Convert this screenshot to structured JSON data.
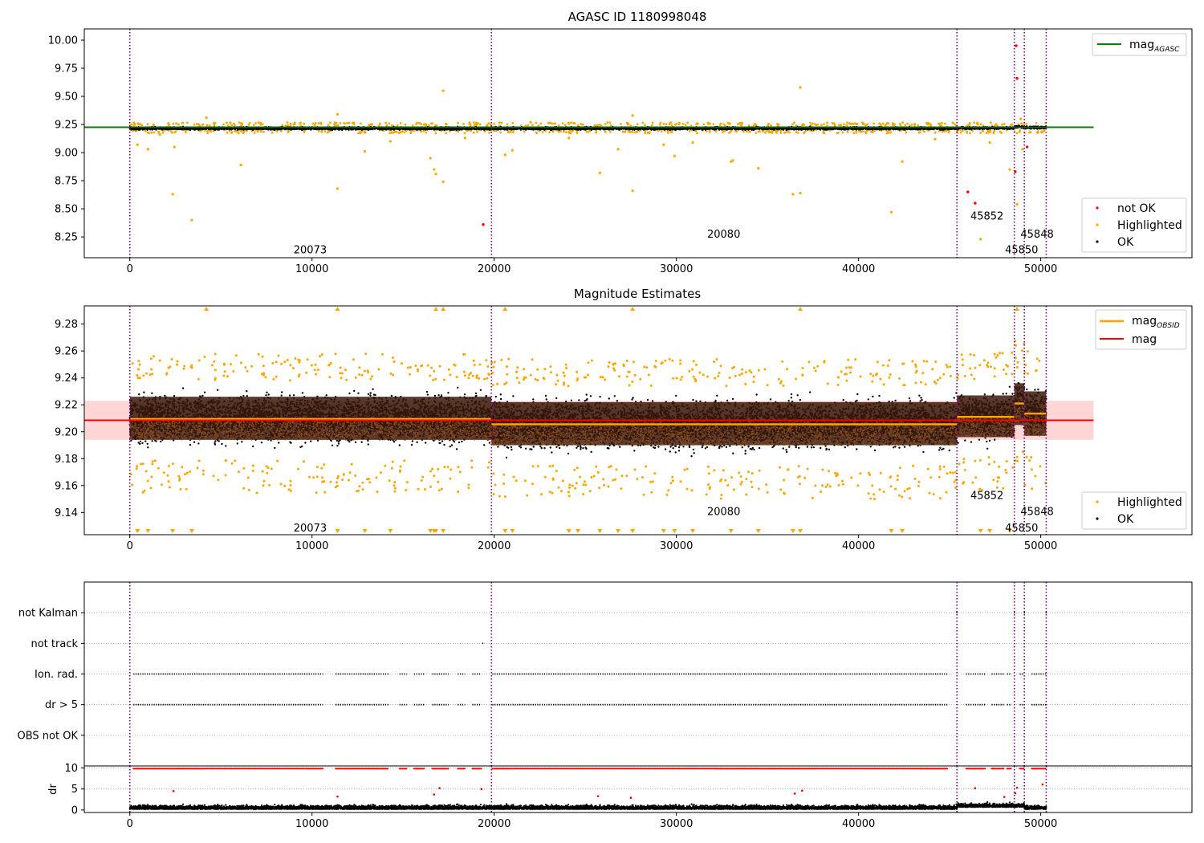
{
  "colors": {
    "ok": "#000000",
    "highlighted": "#ffa500",
    "not_ok": "#ff0000",
    "mag_agasc": "#008000",
    "mag_obsid": "#ffa500",
    "mag": "#ff0000",
    "mag_band": "#ffd6d6",
    "obsid_band": "#3a1a0a",
    "vline": "#800080"
  },
  "chart_data": [
    {
      "type": "scatter",
      "title": "AGASC ID 1180998048",
      "xlim": [
        -2500,
        58300
      ],
      "ylim": [
        8.065,
        10.1
      ],
      "xticks": [
        0,
        10000,
        20000,
        30000,
        40000,
        50000
      ],
      "yticks": [
        8.25,
        8.5,
        8.75,
        9.0,
        9.25,
        9.5,
        9.75,
        10.0
      ],
      "ytick_labels": [
        "8.25",
        "8.50",
        "8.75",
        "9.00",
        "9.25",
        "9.50",
        "9.75",
        "10.00"
      ],
      "grid": false,
      "obsid_boundaries": [
        0,
        19850,
        45400,
        48550,
        49100,
        50300
      ],
      "obsid_labels": [
        {
          "text": "20073",
          "x": 9900,
          "y": 8.14
        },
        {
          "text": "20080",
          "x": 32600,
          "y": 8.28
        },
        {
          "text": "45852",
          "x": 47050,
          "y": 8.44
        },
        {
          "text": "45848",
          "x": 49800,
          "y": 8.28
        },
        {
          "text": "45850",
          "x": 48950,
          "y": 8.14
        }
      ],
      "lines": [
        {
          "name": "mag_AGASC",
          "label_main": "mag",
          "label_sub": "AGASC",
          "y": 9.225,
          "x_range": [
            -2500,
            52900
          ]
        }
      ],
      "band": {
        "center": 9.21,
        "half_width": 0.018
      },
      "highlighted_points": [
        {
          "x": 420,
          "y": 9.07
        },
        {
          "x": 1000,
          "y": 9.03
        },
        {
          "x": 1650,
          "y": 9.16
        },
        {
          "x": 2350,
          "y": 8.63
        },
        {
          "x": 2450,
          "y": 9.05
        },
        {
          "x": 3400,
          "y": 8.4
        },
        {
          "x": 4200,
          "y": 9.31
        },
        {
          "x": 6100,
          "y": 8.89
        },
        {
          "x": 11400,
          "y": 8.68
        },
        {
          "x": 11400,
          "y": 9.34
        },
        {
          "x": 12900,
          "y": 9.01
        },
        {
          "x": 14300,
          "y": 9.1
        },
        {
          "x": 16500,
          "y": 8.95
        },
        {
          "x": 16700,
          "y": 8.85
        },
        {
          "x": 16800,
          "y": 8.81
        },
        {
          "x": 17200,
          "y": 9.55
        },
        {
          "x": 17200,
          "y": 8.74
        },
        {
          "x": 18400,
          "y": 9.13
        },
        {
          "x": 20600,
          "y": 8.98
        },
        {
          "x": 21000,
          "y": 9.02
        },
        {
          "x": 22000,
          "y": 9.27
        },
        {
          "x": 24100,
          "y": 9.13
        },
        {
          "x": 25800,
          "y": 8.82
        },
        {
          "x": 26800,
          "y": 9.03
        },
        {
          "x": 27600,
          "y": 8.66
        },
        {
          "x": 27600,
          "y": 9.33
        },
        {
          "x": 29300,
          "y": 9.07
        },
        {
          "x": 29900,
          "y": 8.97
        },
        {
          "x": 30900,
          "y": 9.09
        },
        {
          "x": 33000,
          "y": 8.92
        },
        {
          "x": 33100,
          "y": 8.93
        },
        {
          "x": 34500,
          "y": 8.86
        },
        {
          "x": 36400,
          "y": 8.63
        },
        {
          "x": 36800,
          "y": 8.64
        },
        {
          "x": 36800,
          "y": 9.58
        },
        {
          "x": 41800,
          "y": 8.47
        },
        {
          "x": 42400,
          "y": 8.92
        },
        {
          "x": 46700,
          "y": 8.23
        },
        {
          "x": 47200,
          "y": 9.09
        },
        {
          "x": 48300,
          "y": 8.85
        },
        {
          "x": 48700,
          "y": 8.54
        },
        {
          "x": 48900,
          "y": 9.3
        },
        {
          "x": 49000,
          "y": 9.03
        },
        {
          "x": 44200,
          "y": 9.12
        }
      ],
      "not_ok_points": [
        {
          "x": 19400,
          "y": 8.36
        },
        {
          "x": 46000,
          "y": 8.65
        },
        {
          "x": 46400,
          "y": 8.55
        },
        {
          "x": 48600,
          "y": 8.83
        },
        {
          "x": 48700,
          "y": 9.66
        },
        {
          "x": 48650,
          "y": 9.95
        },
        {
          "x": 49250,
          "y": 9.05
        }
      ],
      "legends": [
        {
          "position": "upper-right",
          "entries": [
            {
              "kind": "line",
              "main": "mag",
              "sub": "AGASC",
              "color_key": "mag_agasc"
            }
          ]
        },
        {
          "position": "lower-right",
          "entries": [
            {
              "kind": "point",
              "label": "not OK",
              "color_key": "not_ok"
            },
            {
              "kind": "point",
              "label": "Highlighted",
              "color_key": "highlighted"
            },
            {
              "kind": "point",
              "label": "OK",
              "color_key": "ok"
            }
          ]
        }
      ]
    },
    {
      "type": "scatter",
      "title": "Magnitude Estimates",
      "xlim": [
        -2500,
        58300
      ],
      "ylim": [
        9.1235,
        9.2935
      ],
      "xticks": [
        0,
        10000,
        20000,
        30000,
        40000,
        50000
      ],
      "yticks": [
        9.14,
        9.16,
        9.18,
        9.2,
        9.22,
        9.24,
        9.26,
        9.28
      ],
      "ytick_labels": [
        "9.14",
        "9.16",
        "9.18",
        "9.20",
        "9.22",
        "9.24",
        "9.26",
        "9.28"
      ],
      "grid": false,
      "obsid_boundaries": [
        0,
        19850,
        45400,
        48550,
        49100,
        50300
      ],
      "obsid_labels": [
        {
          "text": "20073",
          "x": 9900,
          "y": 9.129
        },
        {
          "text": "20080",
          "x": 32600,
          "y": 9.141
        },
        {
          "text": "45852",
          "x": 47050,
          "y": 9.153
        },
        {
          "text": "45848",
          "x": 49800,
          "y": 9.141
        },
        {
          "text": "45850",
          "x": 48950,
          "y": 9.129
        }
      ],
      "mag": {
        "value": 9.2085,
        "band": [
          9.194,
          9.223
        ],
        "x_range": [
          -2500,
          52900
        ]
      },
      "obsid_segments": [
        {
          "x0": 0,
          "x1": 19850,
          "mag": 9.2095,
          "lo": 9.194,
          "hi": 9.226
        },
        {
          "x0": 19850,
          "x1": 45400,
          "mag": 9.2055,
          "lo": 9.19,
          "hi": 9.222
        },
        {
          "x0": 45400,
          "x1": 48550,
          "mag": 9.211,
          "lo": 9.196,
          "hi": 9.227
        },
        {
          "x0": 48550,
          "x1": 49100,
          "mag": 9.221,
          "lo": 9.205,
          "hi": 9.236
        },
        {
          "x0": 49100,
          "x1": 50300,
          "mag": 9.2135,
          "lo": 9.197,
          "hi": 9.23
        }
      ],
      "highlighted_up_markers_x": [
        4200,
        11400,
        16800,
        17200,
        20600,
        27600,
        36800,
        48700
      ],
      "highlighted_down_markers_x": [
        420,
        1000,
        2350,
        3400,
        11400,
        12900,
        14300,
        16500,
        16700,
        16800,
        17200,
        20600,
        21000,
        24100,
        24600,
        25800,
        26800,
        27600,
        29300,
        29900,
        30900,
        33000,
        34500,
        36400,
        36800,
        41800,
        42400,
        46700,
        47200,
        48300
      ],
      "legends": [
        {
          "position": "upper-right",
          "entries": [
            {
              "kind": "line",
              "main": "mag",
              "sub": "OBSID",
              "color_key": "mag_obsid"
            },
            {
              "kind": "line",
              "main": "mag",
              "sub": "",
              "color_key": "mag"
            }
          ]
        },
        {
          "position": "lower-right",
          "entries": [
            {
              "kind": "point",
              "label": "Highlighted",
              "color_key": "highlighted"
            },
            {
              "kind": "point",
              "label": "OK",
              "color_key": "ok"
            }
          ]
        }
      ]
    },
    {
      "type": "scatter",
      "title": "",
      "xlim": [
        -2500,
        58300
      ],
      "categories": [
        "OBS not OK",
        "dr > 5",
        "Ion. rad.",
        "not track",
        "not Kalman"
      ],
      "grid": true,
      "obsid_boundaries": [
        0,
        19850,
        45400,
        48550,
        49100,
        50300
      ],
      "flag_runs": [
        {
          "category": "Ion. rad.",
          "ranges": [
            [
              200,
              10600
            ],
            [
              11300,
              14200
            ],
            [
              14800,
              15200
            ],
            [
              15600,
              16200
            ],
            [
              16600,
              17500
            ],
            [
              18000,
              18400
            ],
            [
              18800,
              19300
            ],
            [
              19900,
              44900
            ],
            [
              45900,
              47000
            ],
            [
              47300,
              48000
            ],
            [
              48150,
              48400
            ],
            [
              48850,
              49100
            ],
            [
              49500,
              50300
            ]
          ]
        },
        {
          "category": "dr > 5",
          "ranges": [
            [
              200,
              10600
            ],
            [
              11300,
              14200
            ],
            [
              14800,
              15200
            ],
            [
              15600,
              16200
            ],
            [
              16600,
              17500
            ],
            [
              18000,
              18400
            ],
            [
              18800,
              19300
            ],
            [
              19900,
              44900
            ],
            [
              45900,
              47000
            ],
            [
              47300,
              48000
            ],
            [
              48150,
              48400
            ],
            [
              48850,
              49100
            ],
            [
              49500,
              50300
            ]
          ]
        },
        {
          "category": "not track",
          "ranges": [
            [
              19350,
              19450
            ]
          ]
        },
        {
          "category": "not Kalman",
          "ranges": [
            [
              45370,
              45430
            ],
            [
              48530,
              48580
            ],
            [
              49080,
              49130
            ],
            [
              50270,
              50320
            ]
          ]
        }
      ]
    },
    {
      "type": "scatter",
      "title": "",
      "ylabel": "dr",
      "xlim": [
        -2500,
        58300
      ],
      "ylim": [
        -0.6,
        10.5
      ],
      "xticks": [
        0,
        10000,
        20000,
        30000,
        40000,
        50000
      ],
      "xtick_labels": [
        "0",
        "10000",
        "20000",
        "30000",
        "40000",
        "50000"
      ],
      "yticks": [
        0,
        5,
        10
      ],
      "ytick_labels": [
        "0",
        "5",
        "10"
      ],
      "grid": true,
      "obsid_boundaries": [
        0,
        19850,
        45400,
        48550,
        49100,
        50300
      ],
      "clip_value": 10,
      "outlier_points": [
        {
          "x": 2400,
          "y": 4.5
        },
        {
          "x": 11400,
          "y": 3.2
        },
        {
          "x": 16700,
          "y": 3.7
        },
        {
          "x": 17000,
          "y": 5.2
        },
        {
          "x": 19300,
          "y": 5.0
        },
        {
          "x": 25700,
          "y": 3.3
        },
        {
          "x": 27500,
          "y": 2.9
        },
        {
          "x": 36500,
          "y": 3.9
        },
        {
          "x": 36900,
          "y": 4.6
        },
        {
          "x": 46400,
          "y": 5.2
        },
        {
          "x": 48000,
          "y": 3.1
        },
        {
          "x": 48600,
          "y": 4.0
        },
        {
          "x": 48700,
          "y": 5.3
        },
        {
          "x": 50100,
          "y": 6.1
        }
      ]
    }
  ]
}
